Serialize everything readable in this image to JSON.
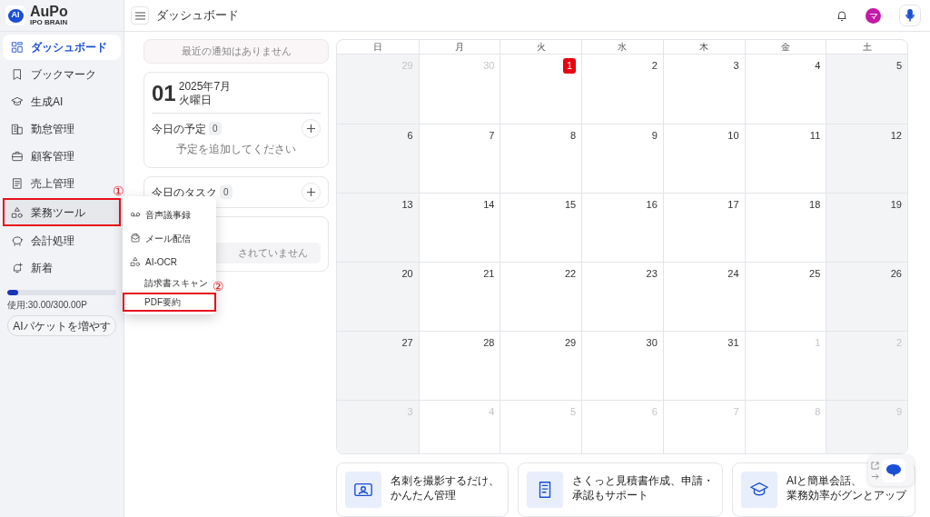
{
  "app": {
    "logo_badge": "AI",
    "logo_text": "AuPo",
    "logo_sub": "IPO BRAIN"
  },
  "header": {
    "title": "ダッシュボード",
    "avatar": "マ"
  },
  "sidebar": {
    "items": [
      {
        "label": "ダッシュボード",
        "selected": true,
        "highlighted": false
      },
      {
        "label": "ブックマーク",
        "selected": false,
        "highlighted": false
      },
      {
        "label": "生成AI",
        "selected": false,
        "highlighted": false
      },
      {
        "label": "勤怠管理",
        "selected": false,
        "highlighted": false
      },
      {
        "label": "顧客管理",
        "selected": false,
        "highlighted": false
      },
      {
        "label": "売上管理",
        "selected": false,
        "highlighted": false
      },
      {
        "label": "業務ツール",
        "selected": false,
        "highlighted": true,
        "annotation": "①"
      },
      {
        "label": "会計処理",
        "selected": false,
        "highlighted": false
      },
      {
        "label": "新着",
        "selected": false,
        "highlighted": false
      }
    ],
    "usage": {
      "level": 0.1,
      "text": "使用:30.00/300.00P"
    },
    "button": "AIパケットを増やす"
  },
  "submenu": {
    "items": [
      {
        "label": "音声議事録",
        "highlighted": false
      },
      {
        "label": "メール配信",
        "highlighted": false
      },
      {
        "label": "AI-OCR",
        "highlighted": false,
        "children": [
          {
            "label": "請求書スキャン",
            "highlighted": false
          },
          {
            "label": "PDF要約",
            "highlighted": true,
            "annotation": "②"
          }
        ]
      }
    ]
  },
  "notice": "最近の通知はありません",
  "date_card": {
    "day": "01",
    "month": "2025年7月",
    "weekday": "火曜日",
    "schedule": {
      "title": "今日の予定",
      "count": "0",
      "empty": "予定を追加してください"
    }
  },
  "task_card": {
    "title": "今日のタスク",
    "count": "0"
  },
  "third_card": {
    "text": "されていません"
  },
  "calendar": {
    "weekdays": [
      "日",
      "月",
      "火",
      "水",
      "木",
      "金",
      "土"
    ],
    "weeks": [
      [
        {
          "day": "29",
          "in_month": false,
          "today": false
        },
        {
          "day": "30",
          "in_month": false,
          "today": false
        },
        {
          "day": "1",
          "in_month": true,
          "today": true
        },
        {
          "day": "2",
          "in_month": true,
          "today": false
        },
        {
          "day": "3",
          "in_month": true,
          "today": false
        },
        {
          "day": "4",
          "in_month": true,
          "today": false
        },
        {
          "day": "5",
          "in_month": true,
          "today": false
        }
      ],
      [
        {
          "day": "6",
          "in_month": true,
          "today": false
        },
        {
          "day": "7",
          "in_month": true,
          "today": false
        },
        {
          "day": "8",
          "in_month": true,
          "today": false
        },
        {
          "day": "9",
          "in_month": true,
          "today": false
        },
        {
          "day": "10",
          "in_month": true,
          "today": false
        },
        {
          "day": "11",
          "in_month": true,
          "today": false
        },
        {
          "day": "12",
          "in_month": true,
          "today": false
        }
      ],
      [
        {
          "day": "13",
          "in_month": true,
          "today": false
        },
        {
          "day": "14",
          "in_month": true,
          "today": false
        },
        {
          "day": "15",
          "in_month": true,
          "today": false
        },
        {
          "day": "16",
          "in_month": true,
          "today": false
        },
        {
          "day": "17",
          "in_month": true,
          "today": false
        },
        {
          "day": "18",
          "in_month": true,
          "today": false
        },
        {
          "day": "19",
          "in_month": true,
          "today": false
        }
      ],
      [
        {
          "day": "20",
          "in_month": true,
          "today": false
        },
        {
          "day": "21",
          "in_month": true,
          "today": false
        },
        {
          "day": "22",
          "in_month": true,
          "today": false
        },
        {
          "day": "23",
          "in_month": true,
          "today": false
        },
        {
          "day": "24",
          "in_month": true,
          "today": false
        },
        {
          "day": "25",
          "in_month": true,
          "today": false
        },
        {
          "day": "26",
          "in_month": true,
          "today": false
        }
      ],
      [
        {
          "day": "27",
          "in_month": true,
          "today": false
        },
        {
          "day": "28",
          "in_month": true,
          "today": false
        },
        {
          "day": "29",
          "in_month": true,
          "today": false
        },
        {
          "day": "30",
          "in_month": true,
          "today": false
        },
        {
          "day": "31",
          "in_month": true,
          "today": false
        },
        {
          "day": "1",
          "in_month": false,
          "today": false
        },
        {
          "day": "2",
          "in_month": false,
          "today": false
        }
      ],
      [
        {
          "day": "3",
          "in_month": false,
          "today": false
        },
        {
          "day": "4",
          "in_month": false,
          "today": false
        },
        {
          "day": "5",
          "in_month": false,
          "today": false
        },
        {
          "day": "6",
          "in_month": false,
          "today": false
        },
        {
          "day": "7",
          "in_month": false,
          "today": false
        },
        {
          "day": "8",
          "in_month": false,
          "today": false
        },
        {
          "day": "9",
          "in_month": false,
          "today": false
        }
      ]
    ]
  },
  "promos": [
    {
      "lines": [
        "名刺を撮影するだけ、",
        "かんたん管理"
      ]
    },
    {
      "lines": [
        "さくっと見積書作成、申請・",
        "承認もサポート"
      ]
    },
    {
      "lines": [
        "AIと簡単会話、",
        "業務効率がグンとアップ"
      ]
    }
  ]
}
